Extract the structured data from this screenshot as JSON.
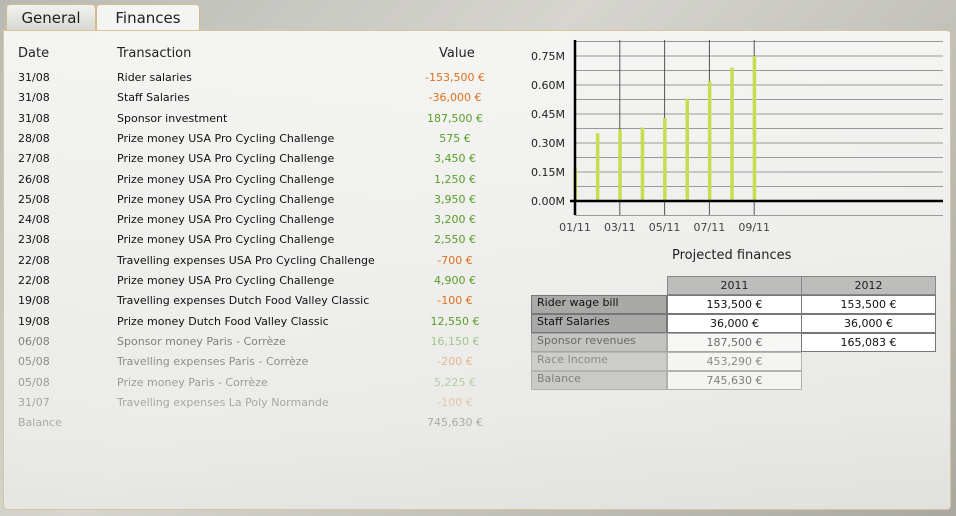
{
  "tabs": [
    {
      "label": "General"
    },
    {
      "label": "Finances",
      "active": true
    }
  ],
  "transactions": {
    "headers": {
      "date": "Date",
      "transaction": "Transaction",
      "value": "Value"
    },
    "rows": [
      {
        "date": "31/08",
        "transaction": "Rider salaries",
        "value": "-153,500 €",
        "type": "neg"
      },
      {
        "date": "31/08",
        "transaction": "Staff Salaries",
        "value": "-36,000 €",
        "type": "neg"
      },
      {
        "date": "31/08",
        "transaction": "Sponsor investment",
        "value": "187,500 €",
        "type": "pos"
      },
      {
        "date": "28/08",
        "transaction": "Prize money USA Pro Cycling Challenge",
        "value": "575 €",
        "type": "pos"
      },
      {
        "date": "27/08",
        "transaction": "Prize money USA Pro Cycling Challenge",
        "value": "3,450 €",
        "type": "pos"
      },
      {
        "date": "26/08",
        "transaction": "Prize money USA Pro Cycling Challenge",
        "value": "1,250 €",
        "type": "pos"
      },
      {
        "date": "25/08",
        "transaction": "Prize money USA Pro Cycling Challenge",
        "value": "3,950 €",
        "type": "pos"
      },
      {
        "date": "24/08",
        "transaction": "Prize money USA Pro Cycling Challenge",
        "value": "3,200 €",
        "type": "pos"
      },
      {
        "date": "23/08",
        "transaction": "Prize money USA Pro Cycling Challenge",
        "value": "2,550 €",
        "type": "pos"
      },
      {
        "date": "22/08",
        "transaction": "Travelling expenses USA Pro Cycling Challenge",
        "value": "-700 €",
        "type": "neg"
      },
      {
        "date": "22/08",
        "transaction": "Prize money USA Pro Cycling Challenge",
        "value": "4,900 €",
        "type": "pos"
      },
      {
        "date": "19/08",
        "transaction": "Travelling expenses Dutch Food Valley Classic",
        "value": "-100 €",
        "type": "neg"
      },
      {
        "date": "19/08",
        "transaction": "Prize money Dutch Food Valley Classic",
        "value": "12,550 €",
        "type": "pos"
      },
      {
        "date": "06/08",
        "transaction": "Sponsor money Paris - Corrèze",
        "value": "16,150 €",
        "type": "pos"
      },
      {
        "date": "05/08",
        "transaction": "Travelling expenses Paris - Corrèze",
        "value": "-200 €",
        "type": "neg"
      },
      {
        "date": "05/08",
        "transaction": "Prize money Paris - Corrèze",
        "value": "5,225 €",
        "type": "pos"
      },
      {
        "date": "31/07",
        "transaction": "Travelling expenses La Poly Normande",
        "value": "-100 €",
        "type": "neg"
      }
    ],
    "balance": {
      "label": "Balance",
      "value": "745,630 €"
    }
  },
  "colors": {
    "negative": "#e0701e",
    "positive": "#5a9e2a",
    "bar": "#c8dc50"
  },
  "chart_data": {
    "type": "bar",
    "categories": [
      "01/11",
      "02/11",
      "03/11",
      "04/11",
      "05/11",
      "06/11",
      "07/11",
      "08/11",
      "09/11"
    ],
    "values": [
      0.17,
      0.35,
      0.37,
      0.38,
      0.43,
      0.53,
      0.62,
      0.69,
      0.75
    ],
    "x_tick_labels": [
      "01/11",
      "03/11",
      "05/11",
      "07/11",
      "09/11"
    ],
    "y_ticks": [
      "0.00M",
      "0.15M",
      "0.30M",
      "0.45M",
      "0.60M",
      "0.75M"
    ],
    "ylim": [
      0,
      0.75
    ],
    "grid": true,
    "xlabel": "",
    "ylabel": ""
  },
  "projected": {
    "title": "Projected finances",
    "columns": [
      "2011",
      "2012"
    ],
    "rows": [
      {
        "label": "Rider wage bill",
        "values": [
          "153,500 €",
          "153,500 €"
        ]
      },
      {
        "label": "Staff Salaries",
        "values": [
          "36,000 €",
          "36,000 €"
        ]
      },
      {
        "label": "Sponsor revenues",
        "values": [
          "187,500 €",
          "165,083 €"
        ]
      },
      {
        "label": "Race Income",
        "values": [
          "453,290 €"
        ]
      },
      {
        "label": "Balance",
        "values": [
          "745,630 €"
        ]
      }
    ]
  }
}
